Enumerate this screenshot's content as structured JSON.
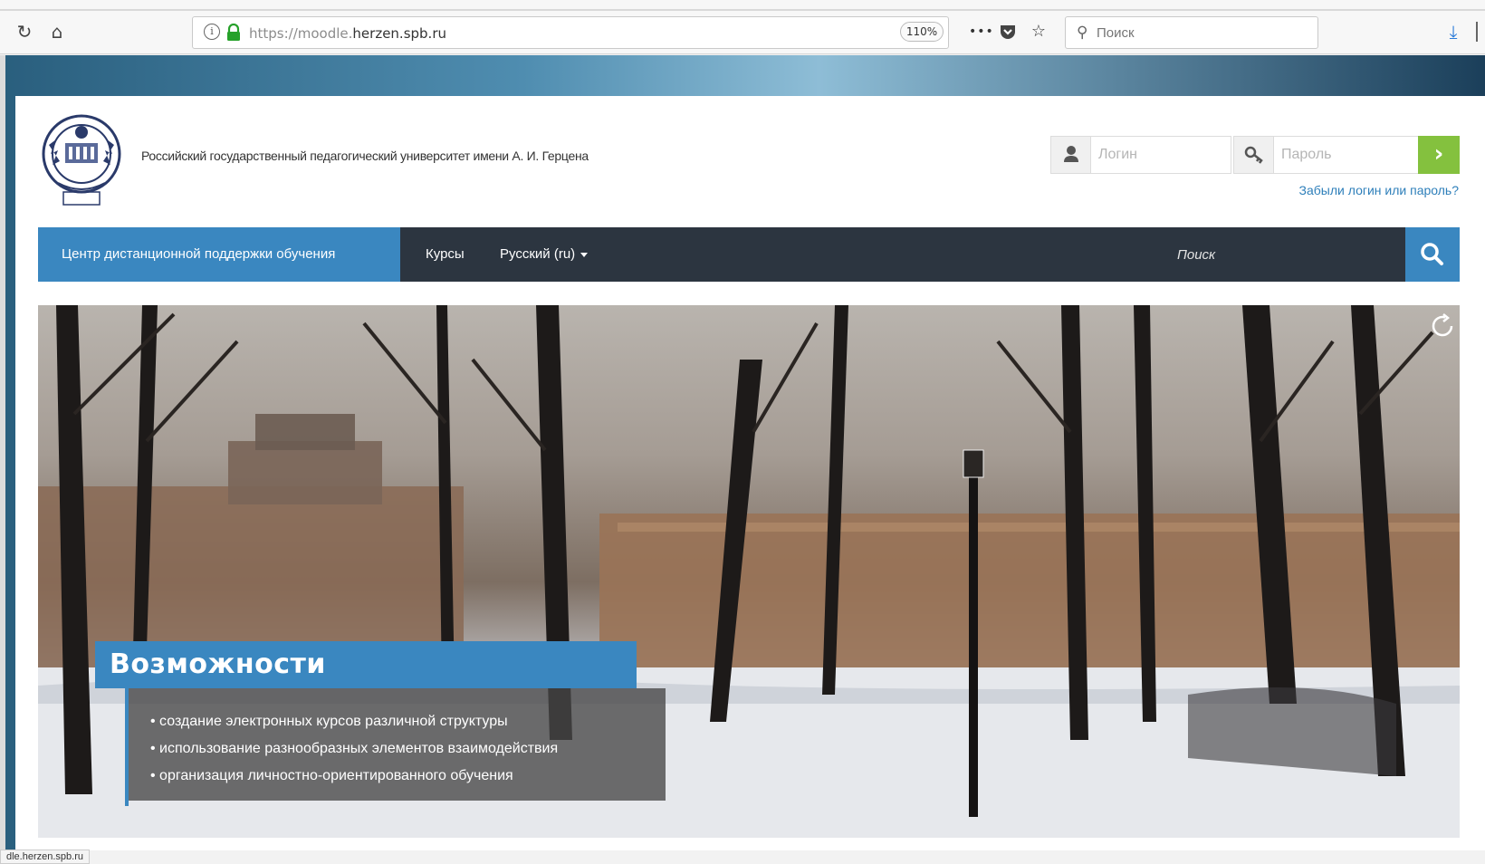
{
  "browser": {
    "url_prefix": "https://moodle.",
    "url_domain": "herzen.spb.ru",
    "zoom": "110%",
    "more_icon": "•••",
    "search_placeholder": "Поиск",
    "status_url": "dle.herzen.spb.ru"
  },
  "header": {
    "university_name": "Российский государственный педагогический университет имени А. И. Герцена",
    "login_placeholder": "Логин",
    "password_placeholder": "Пароль",
    "go_label": "›",
    "forgot_link": "Забыли логин или пароль?"
  },
  "nav": {
    "brand": "Центр дистанционной поддержки обучения",
    "courses": "Курсы",
    "language": "Русский (ru)",
    "search_placeholder": "Поиск"
  },
  "hero": {
    "title": "Возможности",
    "bullets": [
      "• создание электронных курсов различной структуры",
      "• использование разнообразных элементов взаимодействия",
      "• организация личностно-ориентированного обучения"
    ]
  },
  "colors": {
    "accent_blue": "#3a87c0",
    "nav_dark": "#2c3540",
    "go_green": "#84c13e",
    "link_blue": "#2e7fba"
  }
}
